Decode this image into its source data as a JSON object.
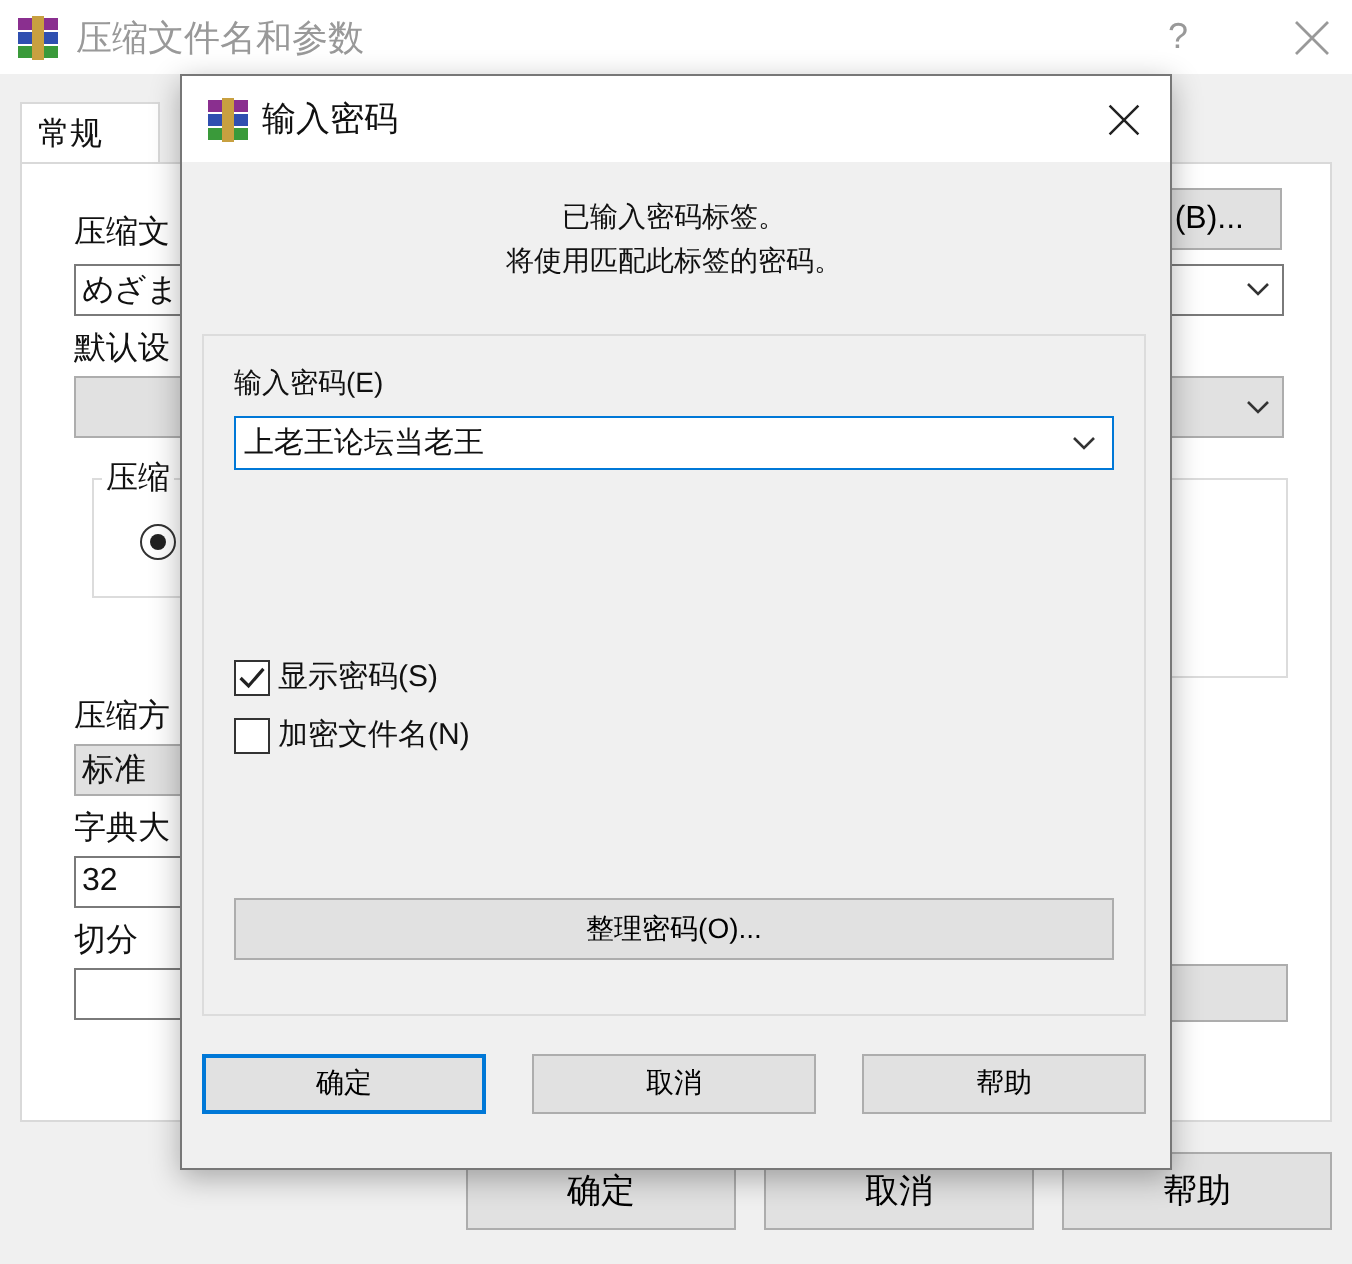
{
  "main_window": {
    "title": "压缩文件名和参数",
    "help_glyph": "?"
  },
  "tabs": [
    {
      "label": "常规",
      "selected": true
    }
  ],
  "form": {
    "archive_name_label": "压缩文",
    "archive_name_value": "めざま",
    "browse_button": "(B)...",
    "profile_label": "默认设",
    "group_label": "压缩",
    "radio_selected": true,
    "method_label": "压缩方",
    "method_value": "标准",
    "dictionary_label": "字典大",
    "dictionary_value": "32",
    "split_label": "切分"
  },
  "buttons": [
    "确定",
    "取消",
    "帮助"
  ],
  "dialog": {
    "title": "输入密码",
    "message": [
      "已输入密码标签。",
      "将使用匹配此标签的密码。"
    ],
    "password_label": "输入密码(E)",
    "password_value": "上老王论坛当老王",
    "options": [
      {
        "label": "显示密码(S)",
        "checked": true
      },
      {
        "label": "加密文件名(N)",
        "checked": false
      }
    ],
    "organize_button": "整理密码(O)...",
    "buttons": [
      {
        "label": "确定",
        "focused": true
      },
      {
        "label": "取消",
        "focused": false
      },
      {
        "label": "帮助",
        "focused": false
      }
    ]
  }
}
